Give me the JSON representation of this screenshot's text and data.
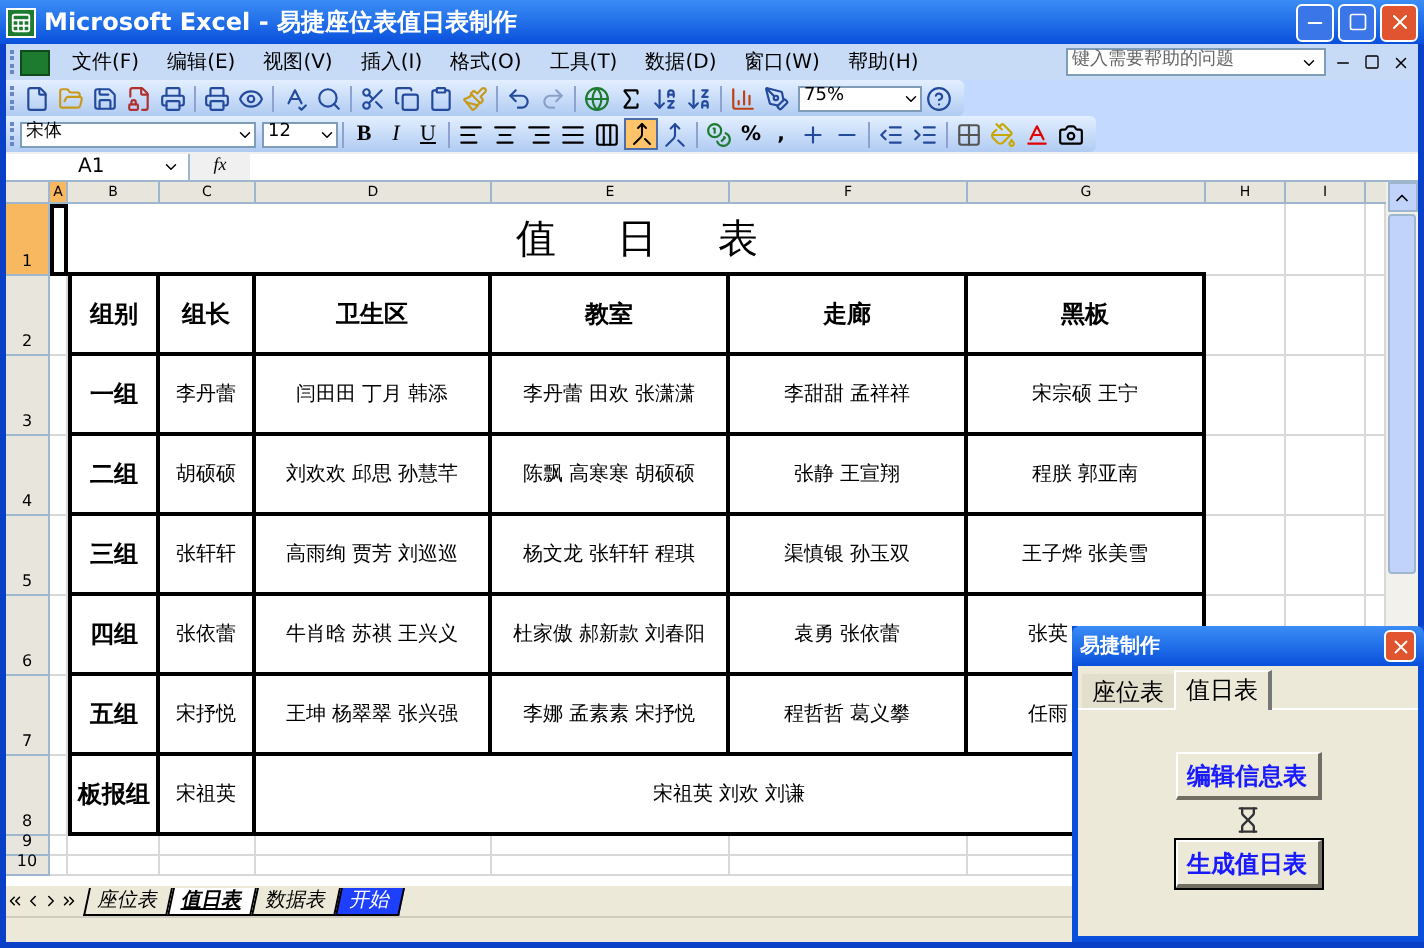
{
  "window": {
    "title": "Microsoft Excel - 易捷座位表值日表制作"
  },
  "menu": [
    "文件(F)",
    "编辑(E)",
    "视图(V)",
    "插入(I)",
    "格式(O)",
    "工具(T)",
    "数据(D)",
    "窗口(W)",
    "帮助(H)"
  ],
  "help_box": {
    "placeholder": "键入需要帮助的问题"
  },
  "standard_toolbar": {
    "zoom": "75%"
  },
  "formatting_toolbar": {
    "font": "宋体",
    "size": "12",
    "style_buttons": [
      "B",
      "I",
      "U"
    ],
    "number_buttons": [
      "%",
      ","
    ]
  },
  "formula_bar": {
    "name_box": "A1",
    "function_label": "fx"
  },
  "sheet": {
    "columns": [
      {
        "label": "A",
        "selected": true
      },
      {
        "label": "B",
        "selected": false
      },
      {
        "label": "C",
        "selected": false
      },
      {
        "label": "D",
        "selected": false
      },
      {
        "label": "E",
        "selected": false
      },
      {
        "label": "F",
        "selected": false
      },
      {
        "label": "G",
        "selected": false
      },
      {
        "label": "H",
        "selected": false
      },
      {
        "label": "I",
        "selected": false
      }
    ],
    "row_numbers": [
      {
        "label": "1",
        "selected": true
      },
      {
        "label": "2",
        "selected": false
      },
      {
        "label": "3",
        "selected": false
      },
      {
        "label": "4",
        "selected": false
      },
      {
        "label": "5",
        "selected": false
      },
      {
        "label": "6",
        "selected": false
      },
      {
        "label": "7",
        "selected": false
      },
      {
        "label": "8",
        "selected": false
      },
      {
        "label": "9",
        "selected": false
      },
      {
        "label": "10",
        "selected": false
      }
    ],
    "title": "值 日 表",
    "header": [
      "组别",
      "组长",
      "卫生区",
      "教室",
      "走廊",
      "黑板"
    ],
    "rows": [
      {
        "kind": "group",
        "group": "一组",
        "leader": "李丹蕾",
        "duties": [
          "闫田田 丁月 韩添",
          "李丹蕾 田欢 张潇潇",
          "李甜甜 孟祥祥",
          "宋宗硕 王宁"
        ]
      },
      {
        "kind": "group",
        "group": "二组",
        "leader": "胡硕硕",
        "duties": [
          "刘欢欢 邱思 孙慧芊",
          "陈飘 高寒寒 胡硕硕",
          "张静 王宣翔",
          "程朕 郭亚南"
        ]
      },
      {
        "kind": "group",
        "group": "三组",
        "leader": "张轩轩",
        "duties": [
          "高雨绚 贾芳 刘巡巡",
          "杨文龙 张轩轩 程琪",
          "渠慎银 孙玉双",
          "王子烨 张美雪"
        ]
      },
      {
        "kind": "group",
        "group": "四组",
        "leader": "张依蕾",
        "duties": [
          "牛肖晗 苏祺 王兴义",
          "杜家傲 郝新款 刘春阳",
          "袁勇 张依蕾",
          "张英"
        ]
      },
      {
        "kind": "group",
        "group": "五组",
        "leader": "宋抒悦",
        "duties": [
          "王坤 杨翠翠 张兴强",
          "李娜 孟素素 宋抒悦",
          "程哲哲 葛义攀",
          "任雨"
        ]
      },
      {
        "kind": "merged",
        "group": "板报组",
        "leader": "宋祖英",
        "duties": [
          "宋祖英 刘欢 刘谦"
        ]
      }
    ]
  },
  "sheet_tabs": [
    {
      "label": "座位表",
      "selected": false,
      "color": "#ece9d8"
    },
    {
      "label": "值日表",
      "selected": true,
      "color": "#ffffff"
    },
    {
      "label": "数据表",
      "selected": false,
      "color": "#ece9d8"
    },
    {
      "label": "开始",
      "selected": false,
      "color": "#1f3fff"
    }
  ],
  "dialog": {
    "title": "易捷制作",
    "tabs": [
      {
        "label": "座位表",
        "selected": false
      },
      {
        "label": "值日表",
        "selected": true
      }
    ],
    "buttons": [
      {
        "label": "编辑信息表",
        "default": false
      },
      {
        "label": "生成值日表",
        "default": true
      }
    ]
  }
}
